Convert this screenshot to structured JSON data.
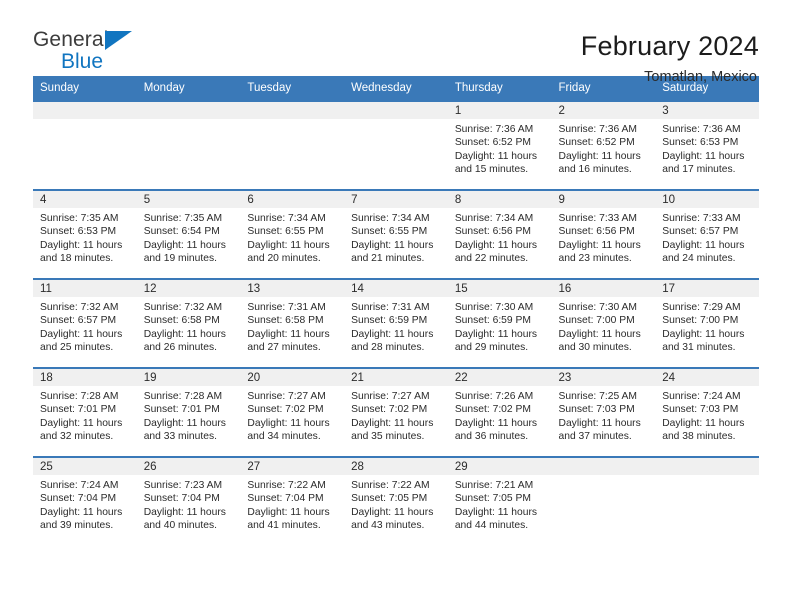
{
  "brand": {
    "name_part1": "General",
    "name_part2": "Blue",
    "triangle_color": "#1175c0"
  },
  "header": {
    "month_title": "February 2024",
    "location": "Tomatlan, Mexico",
    "header_bg": "#3a79b8"
  },
  "weekday_headers": [
    "Sunday",
    "Monday",
    "Tuesday",
    "Wednesday",
    "Thursday",
    "Friday",
    "Saturday"
  ],
  "calendar_cells": [
    {
      "day": "",
      "sunrise": "",
      "sunset": "",
      "daylight1": "",
      "daylight2": "",
      "empty": true
    },
    {
      "day": "",
      "sunrise": "",
      "sunset": "",
      "daylight1": "",
      "daylight2": "",
      "empty": true
    },
    {
      "day": "",
      "sunrise": "",
      "sunset": "",
      "daylight1": "",
      "daylight2": "",
      "empty": true
    },
    {
      "day": "",
      "sunrise": "",
      "sunset": "",
      "daylight1": "",
      "daylight2": "",
      "empty": true
    },
    {
      "day": "1",
      "sunrise": "Sunrise: 7:36 AM",
      "sunset": "Sunset: 6:52 PM",
      "daylight1": "Daylight: 11 hours",
      "daylight2": "and 15 minutes.",
      "empty": false
    },
    {
      "day": "2",
      "sunrise": "Sunrise: 7:36 AM",
      "sunset": "Sunset: 6:52 PM",
      "daylight1": "Daylight: 11 hours",
      "daylight2": "and 16 minutes.",
      "empty": false
    },
    {
      "day": "3",
      "sunrise": "Sunrise: 7:36 AM",
      "sunset": "Sunset: 6:53 PM",
      "daylight1": "Daylight: 11 hours",
      "daylight2": "and 17 minutes.",
      "empty": false
    },
    {
      "day": "4",
      "sunrise": "Sunrise: 7:35 AM",
      "sunset": "Sunset: 6:53 PM",
      "daylight1": "Daylight: 11 hours",
      "daylight2": "and 18 minutes.",
      "empty": false
    },
    {
      "day": "5",
      "sunrise": "Sunrise: 7:35 AM",
      "sunset": "Sunset: 6:54 PM",
      "daylight1": "Daylight: 11 hours",
      "daylight2": "and 19 minutes.",
      "empty": false
    },
    {
      "day": "6",
      "sunrise": "Sunrise: 7:34 AM",
      "sunset": "Sunset: 6:55 PM",
      "daylight1": "Daylight: 11 hours",
      "daylight2": "and 20 minutes.",
      "empty": false
    },
    {
      "day": "7",
      "sunrise": "Sunrise: 7:34 AM",
      "sunset": "Sunset: 6:55 PM",
      "daylight1": "Daylight: 11 hours",
      "daylight2": "and 21 minutes.",
      "empty": false
    },
    {
      "day": "8",
      "sunrise": "Sunrise: 7:34 AM",
      "sunset": "Sunset: 6:56 PM",
      "daylight1": "Daylight: 11 hours",
      "daylight2": "and 22 minutes.",
      "empty": false
    },
    {
      "day": "9",
      "sunrise": "Sunrise: 7:33 AM",
      "sunset": "Sunset: 6:56 PM",
      "daylight1": "Daylight: 11 hours",
      "daylight2": "and 23 minutes.",
      "empty": false
    },
    {
      "day": "10",
      "sunrise": "Sunrise: 7:33 AM",
      "sunset": "Sunset: 6:57 PM",
      "daylight1": "Daylight: 11 hours",
      "daylight2": "and 24 minutes.",
      "empty": false
    },
    {
      "day": "11",
      "sunrise": "Sunrise: 7:32 AM",
      "sunset": "Sunset: 6:57 PM",
      "daylight1": "Daylight: 11 hours",
      "daylight2": "and 25 minutes.",
      "empty": false
    },
    {
      "day": "12",
      "sunrise": "Sunrise: 7:32 AM",
      "sunset": "Sunset: 6:58 PM",
      "daylight1": "Daylight: 11 hours",
      "daylight2": "and 26 minutes.",
      "empty": false
    },
    {
      "day": "13",
      "sunrise": "Sunrise: 7:31 AM",
      "sunset": "Sunset: 6:58 PM",
      "daylight1": "Daylight: 11 hours",
      "daylight2": "and 27 minutes.",
      "empty": false
    },
    {
      "day": "14",
      "sunrise": "Sunrise: 7:31 AM",
      "sunset": "Sunset: 6:59 PM",
      "daylight1": "Daylight: 11 hours",
      "daylight2": "and 28 minutes.",
      "empty": false
    },
    {
      "day": "15",
      "sunrise": "Sunrise: 7:30 AM",
      "sunset": "Sunset: 6:59 PM",
      "daylight1": "Daylight: 11 hours",
      "daylight2": "and 29 minutes.",
      "empty": false
    },
    {
      "day": "16",
      "sunrise": "Sunrise: 7:30 AM",
      "sunset": "Sunset: 7:00 PM",
      "daylight1": "Daylight: 11 hours",
      "daylight2": "and 30 minutes.",
      "empty": false
    },
    {
      "day": "17",
      "sunrise": "Sunrise: 7:29 AM",
      "sunset": "Sunset: 7:00 PM",
      "daylight1": "Daylight: 11 hours",
      "daylight2": "and 31 minutes.",
      "empty": false
    },
    {
      "day": "18",
      "sunrise": "Sunrise: 7:28 AM",
      "sunset": "Sunset: 7:01 PM",
      "daylight1": "Daylight: 11 hours",
      "daylight2": "and 32 minutes.",
      "empty": false
    },
    {
      "day": "19",
      "sunrise": "Sunrise: 7:28 AM",
      "sunset": "Sunset: 7:01 PM",
      "daylight1": "Daylight: 11 hours",
      "daylight2": "and 33 minutes.",
      "empty": false
    },
    {
      "day": "20",
      "sunrise": "Sunrise: 7:27 AM",
      "sunset": "Sunset: 7:02 PM",
      "daylight1": "Daylight: 11 hours",
      "daylight2": "and 34 minutes.",
      "empty": false
    },
    {
      "day": "21",
      "sunrise": "Sunrise: 7:27 AM",
      "sunset": "Sunset: 7:02 PM",
      "daylight1": "Daylight: 11 hours",
      "daylight2": "and 35 minutes.",
      "empty": false
    },
    {
      "day": "22",
      "sunrise": "Sunrise: 7:26 AM",
      "sunset": "Sunset: 7:02 PM",
      "daylight1": "Daylight: 11 hours",
      "daylight2": "and 36 minutes.",
      "empty": false
    },
    {
      "day": "23",
      "sunrise": "Sunrise: 7:25 AM",
      "sunset": "Sunset: 7:03 PM",
      "daylight1": "Daylight: 11 hours",
      "daylight2": "and 37 minutes.",
      "empty": false
    },
    {
      "day": "24",
      "sunrise": "Sunrise: 7:24 AM",
      "sunset": "Sunset: 7:03 PM",
      "daylight1": "Daylight: 11 hours",
      "daylight2": "and 38 minutes.",
      "empty": false
    },
    {
      "day": "25",
      "sunrise": "Sunrise: 7:24 AM",
      "sunset": "Sunset: 7:04 PM",
      "daylight1": "Daylight: 11 hours",
      "daylight2": "and 39 minutes.",
      "empty": false
    },
    {
      "day": "26",
      "sunrise": "Sunrise: 7:23 AM",
      "sunset": "Sunset: 7:04 PM",
      "daylight1": "Daylight: 11 hours",
      "daylight2": "and 40 minutes.",
      "empty": false
    },
    {
      "day": "27",
      "sunrise": "Sunrise: 7:22 AM",
      "sunset": "Sunset: 7:04 PM",
      "daylight1": "Daylight: 11 hours",
      "daylight2": "and 41 minutes.",
      "empty": false
    },
    {
      "day": "28",
      "sunrise": "Sunrise: 7:22 AM",
      "sunset": "Sunset: 7:05 PM",
      "daylight1": "Daylight: 11 hours",
      "daylight2": "and 43 minutes.",
      "empty": false
    },
    {
      "day": "29",
      "sunrise": "Sunrise: 7:21 AM",
      "sunset": "Sunset: 7:05 PM",
      "daylight1": "Daylight: 11 hours",
      "daylight2": "and 44 minutes.",
      "empty": false
    },
    {
      "day": "",
      "sunrise": "",
      "sunset": "",
      "daylight1": "",
      "daylight2": "",
      "empty": true
    },
    {
      "day": "",
      "sunrise": "",
      "sunset": "",
      "daylight1": "",
      "daylight2": "",
      "empty": true
    }
  ]
}
